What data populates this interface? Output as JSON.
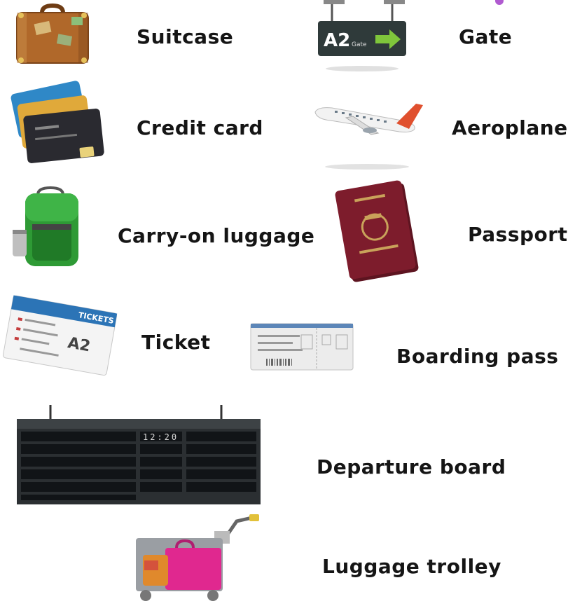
{
  "vocabulary": {
    "suitcase": {
      "label": "Suitcase",
      "icon": "suitcase-icon"
    },
    "gate": {
      "label": "Gate",
      "icon": "gate-sign-icon",
      "sign_text": "A2",
      "sign_subtext": "Gate"
    },
    "credit_card": {
      "label": "Credit card",
      "icon": "credit-card-icon"
    },
    "aeroplane": {
      "label": "Aeroplane",
      "icon": "aeroplane-icon"
    },
    "carry_on_luggage": {
      "label": "Carry-on luggage",
      "icon": "backpack-icon"
    },
    "passport": {
      "label": "Passport",
      "icon": "passport-icon"
    },
    "ticket": {
      "label": "Ticket",
      "icon": "ticket-icon",
      "ticket_text": "A2",
      "ticket_header": "TICKETS"
    },
    "boarding_pass": {
      "label": "Boarding pass",
      "icon": "boarding-pass-icon"
    },
    "departure_board": {
      "label": "Departure board",
      "icon": "departure-board-icon",
      "time": "12:20"
    },
    "luggage_trolley": {
      "label": "Luggage trolley",
      "icon": "luggage-trolley-icon"
    }
  },
  "colors": {
    "suitcase": "#b0682a",
    "gate_sign": "#2f3a3a",
    "gate_arrow": "#7fc63b",
    "card_blue": "#2f88c7",
    "card_dark": "#2a2a30",
    "plane_tail": "#e0502e",
    "backpack": "#2e9a35",
    "passport": "#7d1c2c",
    "ticket_blue": "#2c74b6",
    "board": "#2b2f32",
    "trolley_bag": "#e0288f",
    "accent_purple": "#b05ad0"
  }
}
